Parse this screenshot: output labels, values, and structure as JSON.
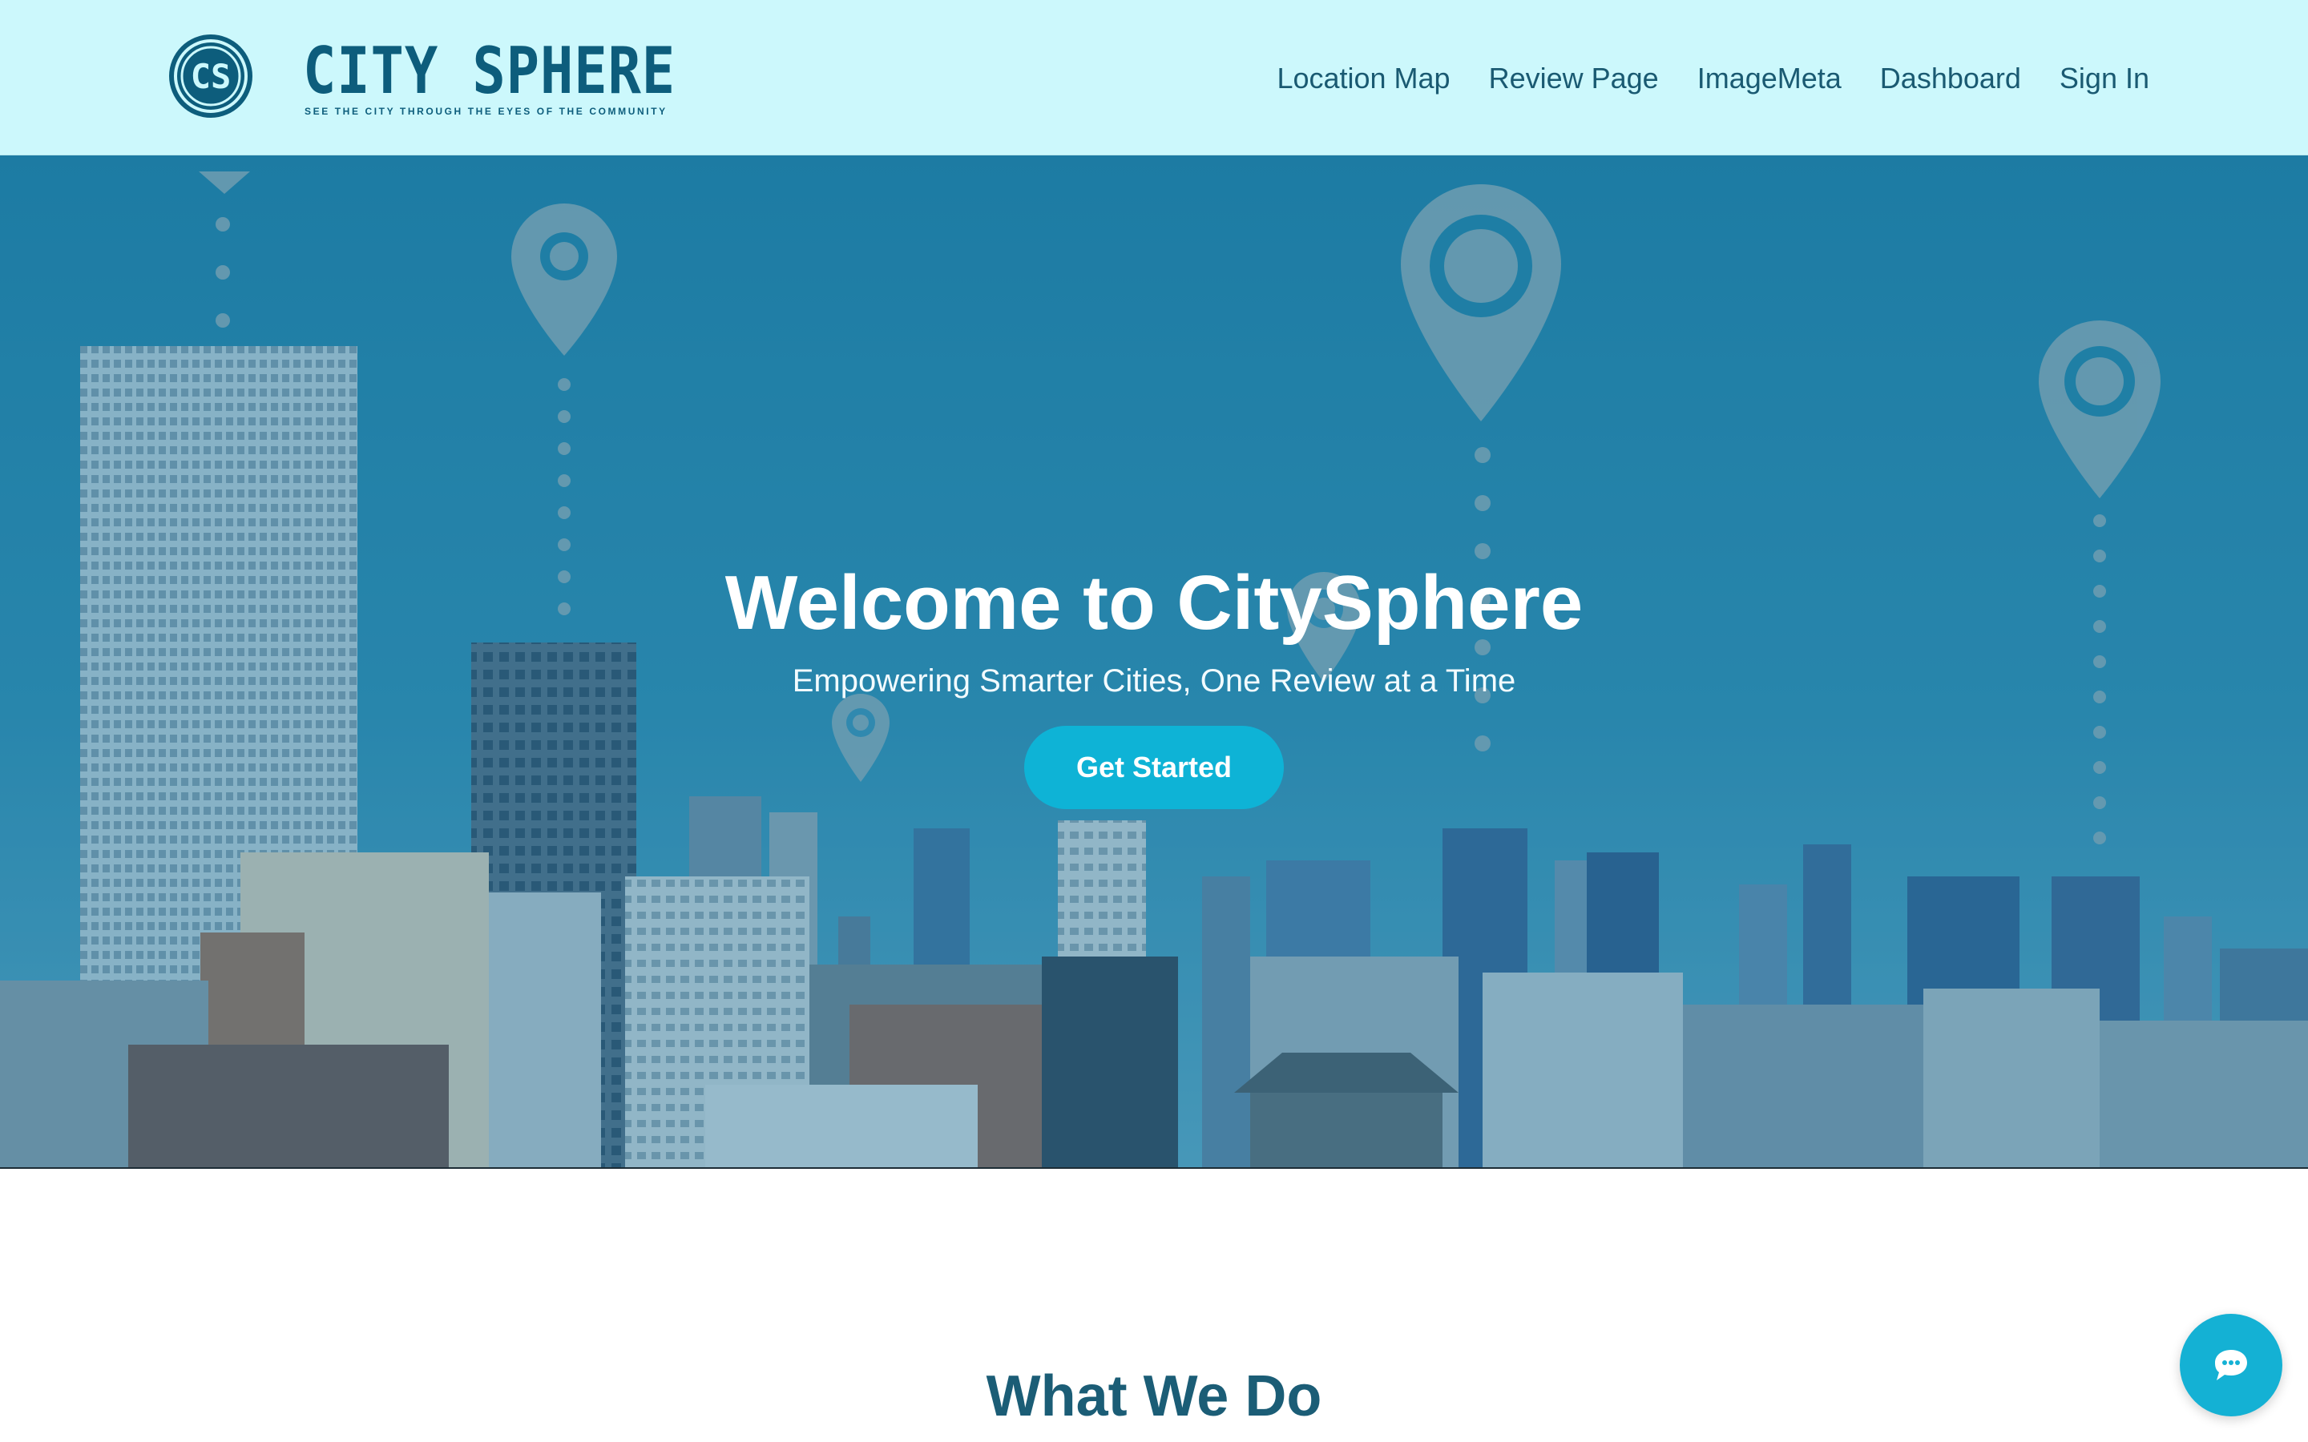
{
  "brand": {
    "name": "CITY SPHERE",
    "tagline": "SEE THE CITY THROUGH THE EYES OF THE COMMUNITY",
    "logo_letters": "CS"
  },
  "nav": {
    "items": [
      {
        "label": "Location Map"
      },
      {
        "label": "Review Page"
      },
      {
        "label": "ImageMeta"
      },
      {
        "label": "Dashboard"
      },
      {
        "label": "Sign In"
      }
    ]
  },
  "hero": {
    "title": "Welcome to CitySphere",
    "subtitle": "Empowering Smarter Cities, One Review at a Time",
    "cta_label": "Get Started",
    "background": "city-skyline-with-location-pins"
  },
  "sections": {
    "what_we_do_heading": "What We Do"
  },
  "chat": {
    "icon": "chat-bubble-icon"
  },
  "colors": {
    "header_bg": "#ccf8fc",
    "brand": "#0d5d7c",
    "nav_text": "#1a5a72",
    "accent": "#0eb3d6",
    "heading": "#1b5d76"
  }
}
